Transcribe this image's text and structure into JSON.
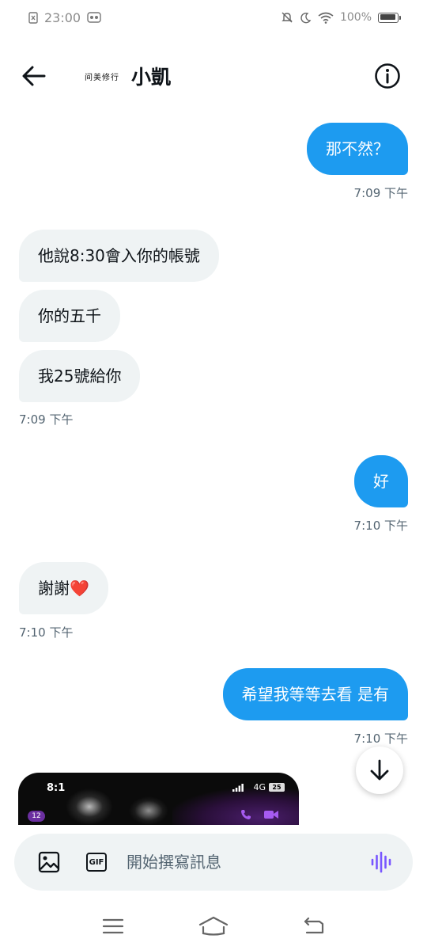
{
  "status_bar": {
    "time": "23:00",
    "battery_text": "100%",
    "icons": [
      "sim-x-icon",
      "app-notification-icon",
      "mute-icon",
      "moon-icon",
      "wifi-icon",
      "battery-icon"
    ]
  },
  "header": {
    "avatar_text": "间美修行",
    "contact_name": "小凱",
    "icons": [
      "back-arrow-icon",
      "info-icon"
    ]
  },
  "messages": [
    {
      "id": "m1",
      "direction": "out",
      "text": "那不然？",
      "timestamp": "7:09 下午"
    },
    {
      "id": "m2",
      "direction": "in",
      "text": "他說8:30會入你的帳號"
    },
    {
      "id": "m3",
      "direction": "in",
      "text": "你的五千"
    },
    {
      "id": "m4",
      "direction": "in",
      "text": "我25號給你",
      "timestamp": "7:09 下午"
    },
    {
      "id": "m5",
      "direction": "out",
      "text": "好",
      "timestamp": "7:10 下午"
    },
    {
      "id": "m6",
      "direction": "in",
      "text": "謝謝",
      "emoji": "❤️",
      "timestamp": "7:10 下午"
    },
    {
      "id": "m7",
      "direction": "out",
      "text": "希望我等等去看 是有",
      "timestamp": "7:10 下午"
    }
  ],
  "image_preview": {
    "time": "8:1",
    "network": "4G",
    "battery": "25",
    "badge": "12"
  },
  "composer": {
    "placeholder": "開始撰寫訊息",
    "gif_label": "GIF",
    "icons": [
      "image-icon",
      "gif-icon",
      "voice-icon"
    ],
    "accent_color": "#7856ff"
  },
  "nav_bar": {
    "icons": [
      "menu-icon",
      "home-icon",
      "back-icon"
    ]
  },
  "colors": {
    "outgoing_bubble": "#1d9bf0",
    "incoming_bubble": "#eff3f4",
    "timestamp": "#536471",
    "heart": "#e0245e"
  }
}
